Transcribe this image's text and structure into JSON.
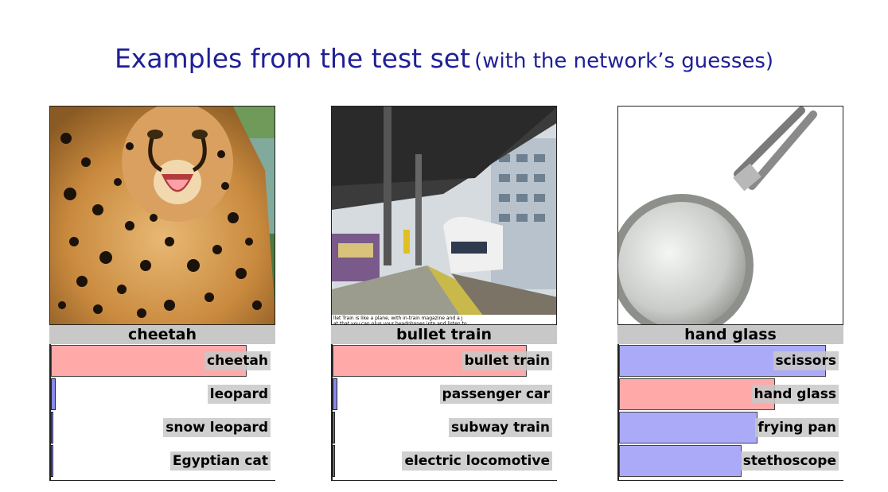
{
  "title": {
    "main": "Examples from the test set",
    "sub": "(with the network’s guesses)"
  },
  "panels": [
    {
      "true_label": "cheetah",
      "image_desc_icon": "cheetah-photo",
      "guesses": [
        {
          "label": "cheetah",
          "score": 0.88,
          "correct": true
        },
        {
          "label": "leopard",
          "score": 0.02,
          "correct": false
        },
        {
          "label": "snow leopard",
          "score": 0.005,
          "correct": false
        },
        {
          "label": "Egyptian cat",
          "score": 0.003,
          "correct": false
        }
      ]
    },
    {
      "true_label": "bullet train",
      "image_caption_text": "llet Train is like a plane, with in-train magazine and a j at that you can plug your headphones into and listen to",
      "guesses": [
        {
          "label": "bullet train",
          "score": 0.87,
          "correct": true
        },
        {
          "label": "passenger car",
          "score": 0.02,
          "correct": false
        },
        {
          "label": "subway train",
          "score": 0.01,
          "correct": false
        },
        {
          "label": "electric locomotive",
          "score": 0.005,
          "correct": false
        }
      ]
    },
    {
      "true_label": "hand glass",
      "guesses": [
        {
          "label": "scissors",
          "score": 0.93,
          "correct": false
        },
        {
          "label": "hand glass",
          "score": 0.7,
          "correct": true
        },
        {
          "label": "frying pan",
          "score": 0.62,
          "correct": false
        },
        {
          "label": "stethoscope",
          "score": 0.55,
          "correct": false
        }
      ]
    }
  ],
  "colors": {
    "title": "#1f2096",
    "correct_bar": "#ffa9a9",
    "wrong_bar": "#abaaf8",
    "caption_bg": "#c8c8c8"
  }
}
